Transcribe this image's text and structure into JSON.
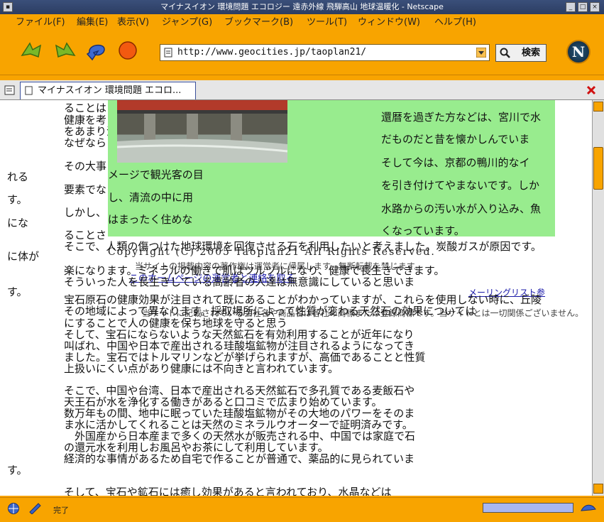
{
  "window": {
    "title": "マイナスイオン 環境問題 エコロジー 遠赤外線 飛騨高山 地球温暖化 - Netscape"
  },
  "menu": [
    "ファイル(F)",
    "編集(E)",
    "表示(V)",
    "ジャンプ(G)",
    "ブックマーク(B)",
    "ツール(T)",
    "ウィンドウ(W)",
    "ヘルプ(H)"
  ],
  "toolbar": {
    "url": "http://www.geocities.jp/taoplan21/",
    "search_label": "検索",
    "logo": "N"
  },
  "tab": {
    "label": "マイナスイオン 環境問題 エコロ..."
  },
  "content": {
    "green_lines": [
      "還暦を過ぎた方などは、宮川で水",
      "だものだと昔を懐かしんでいま",
      "そして今は、京都の鴨川的なイ",
      "を引き付けてやまないです。しか",
      "水路からの汚い水が入り込み、魚",
      "くなっています。"
    ],
    "green_left_lines": [
      "メージで観光客の目",
      "し、清流の中に用",
      "はまったく住めな"
    ],
    "overlay_lines": [
      "ることはま",
      "健康を考",
      "をあまり浴",
      "なぜなら",
      "その大事",
      "要素でな",
      "しかし、",
      "ることさ"
    ],
    "left_fragments": [
      "れる",
      "す。",
      "にな",
      "に体が",
      "す。",
      "す。"
    ],
    "copyright": "Copyright (C) 2005 Taoplan21 All Rights Reserved.",
    "mail_link": "メーリングリスト参",
    "link_text": "このホームページの運営者と連絡を取る",
    "body_lines": [
      "そこで、人類の傷つけた地球環境を回復させる石を利用したいと考えました。炭酸ガスが原因です。",
      "楽になります。ミネラルの働きで肌はツルツルになり、健康で長生きできます。",
      "そういった人を長生きしている高齢者の人達は無意識にしていると思いま",
      "宝石原石の健康効果が注目されて既にあることがわかっていますが、これらを使用しない時に、丘陵",
      "その地域によって異なります。採取場所によって性質が変わる天然石の効果については",
      "にすることで人の健康を保ち地球を守ると思う",
      "そして、宝石にならないような天然鉱石を有効利用することが近年になり",
      "叫ばれ、中国や日本で産出される珪酸塩鉱物が注目されるようになってき",
      "ました。宝石ではトルマリンなどが挙げられますが、高価であることと性質",
      "上扱いにくい点があり健康には不向きと言われています。",
      "そこで、中国や台湾、日本で産出される天然鉱石で多孔質である麦飯石や",
      "天王石が水を浄化する働きがあると口コミで広まり始めています。",
      "数万年もの間、地中に眠っていた珪酸塩鉱物がその大地のパワーをそのま",
      "ま水に活かしてくれることは天然のミネラルウオーターで証明済みです。",
      "　外国産から日本産まで多くの天然水が販売される中、中国では家庭で石",
      "の還元水を利用しお風呂やお茶にして利用しています。",
      "経済的な事情があるため自宅で作ることが普通で、薬品的に見られていま",
      "そして、宝石や鉱石には癒し効果があると言われており、水晶などは"
    ],
    "overlap_lines": [
      "当サイトの掲載内容の著作権は運営者に帰属します。無断転載を禁じます。",
      "当サイトに記載されている会社名や商品名は各社の商標または登録商標です。当サイトとは一切関係ございません。"
    ]
  },
  "status": {
    "text": "完了"
  },
  "colors": {
    "chrome": "#f8a400",
    "green_panel": "#98ec8e",
    "title_bar": "#2c3d62",
    "link": "#1a1aa8"
  }
}
